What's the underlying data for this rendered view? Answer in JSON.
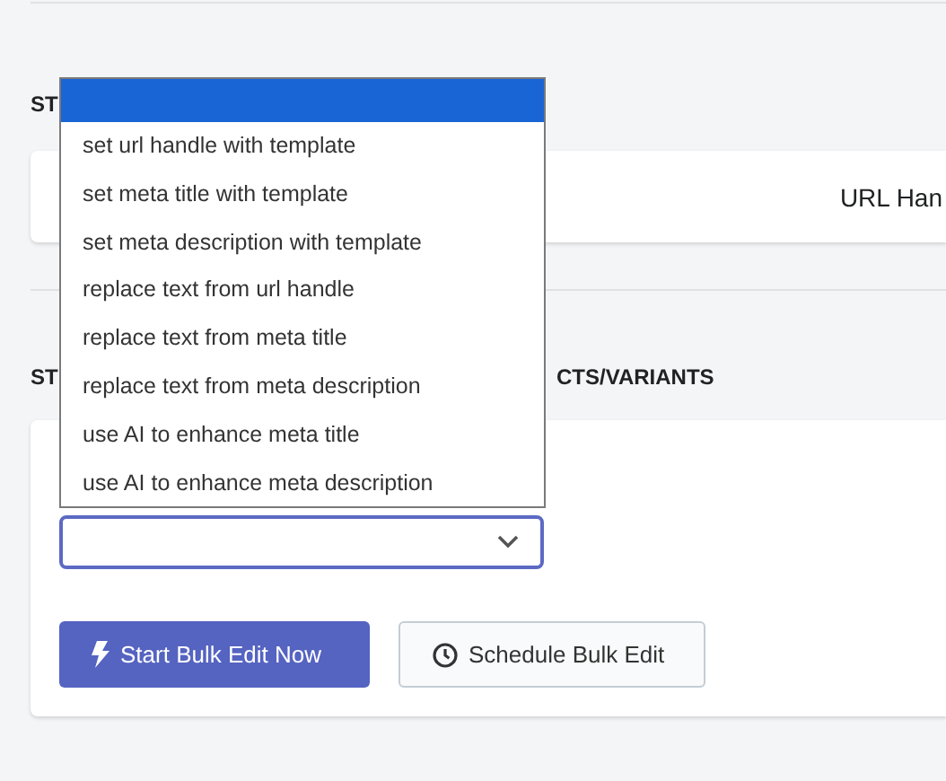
{
  "sections": [
    {
      "heading_parts": [
        "ST"
      ],
      "card": {
        "column_label": "URL Han"
      }
    },
    {
      "heading_parts": [
        "ST",
        "CTS/VARIANTS"
      ],
      "card": {
        "select": {
          "value_shown": false
        },
        "buttons": [
          {
            "label": "Start Bulk Edit Now",
            "kind": "primary"
          },
          {
            "label": "Schedule Bulk Edit",
            "kind": "secondary"
          }
        ]
      }
    }
  ],
  "dropdown": {
    "options": [
      {
        "selected": true
      },
      {
        "label": "set url handle with template",
        "selected": false
      },
      {
        "label": "set meta title with template",
        "selected": false
      },
      {
        "label": "set meta description with template",
        "selected": false
      },
      {
        "label": "replace text from url handle",
        "selected": false
      },
      {
        "label": "replace text from meta title",
        "selected": false
      },
      {
        "label": "replace text from meta description",
        "selected": false
      },
      {
        "label": "use AI to enhance meta title",
        "selected": false
      },
      {
        "label": "use AI to enhance meta description",
        "selected": false
      }
    ]
  }
}
